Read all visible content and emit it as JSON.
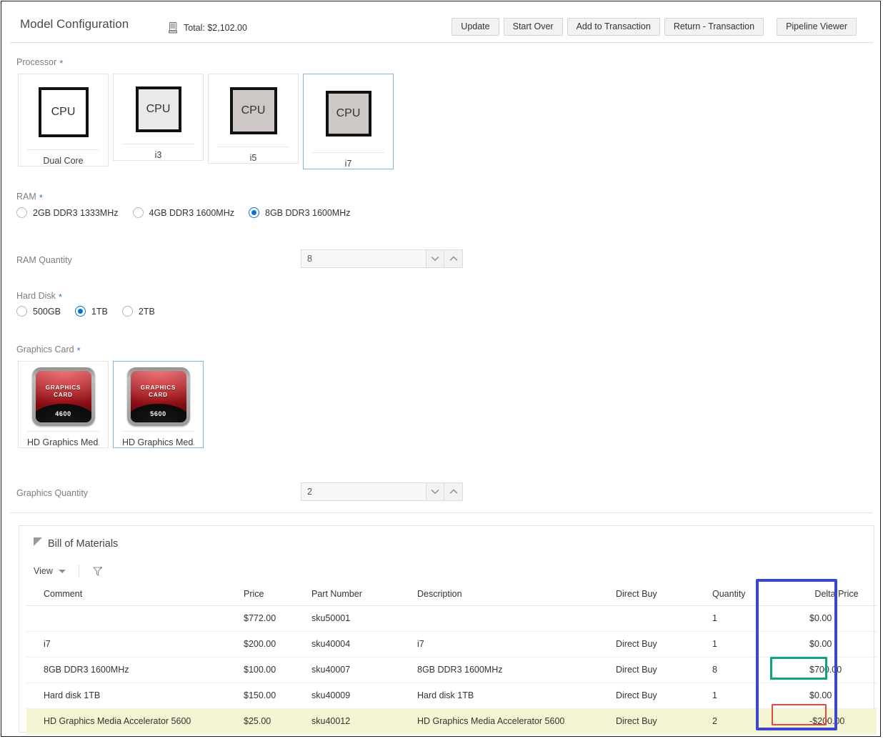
{
  "header": {
    "title": "Model Configuration",
    "total_label": "Total: $2,102.00",
    "total_icon": "server-icon",
    "buttons": [
      {
        "label": "Update",
        "name": "update-button"
      },
      {
        "label": "Start Over",
        "name": "start-over-button"
      },
      {
        "label": "Add to Transaction",
        "name": "add-to-transaction-button"
      },
      {
        "label": "Return - Transaction",
        "name": "return-transaction-button"
      },
      {
        "label": "Pipeline Viewer",
        "name": "pipeline-viewer-button"
      }
    ]
  },
  "form": {
    "processor": {
      "label": "Processor",
      "required": "*",
      "options": [
        {
          "caption": "Dual Core",
          "art": "CPU",
          "fill": "#ffffff",
          "selected": false
        },
        {
          "caption": "i3",
          "art": "CPU",
          "fill": "#ebe9e7",
          "selected": false
        },
        {
          "caption": "i5",
          "art": "CPU",
          "fill": "#cdc7c5",
          "selected": false
        },
        {
          "caption": "i7",
          "art": "CPU",
          "fill": "#cdc7c5",
          "selected": true
        }
      ]
    },
    "ram": {
      "label": "RAM",
      "required": "*",
      "options": [
        {
          "label": "2GB DDR3 1333MHz",
          "selected": false
        },
        {
          "label": "4GB DDR3 1600MHz",
          "selected": false
        },
        {
          "label": "8GB DDR3 1600MHz",
          "selected": true
        }
      ]
    },
    "ram_quantity": {
      "label": "RAM Quantity",
      "value": "8",
      "placeholder": ""
    },
    "hard_disk": {
      "label": "Hard Disk",
      "required": "*",
      "options": [
        {
          "label": "500GB",
          "selected": false
        },
        {
          "label": "1TB",
          "selected": true
        },
        {
          "label": "2TB",
          "selected": false
        }
      ]
    },
    "graphics_card": {
      "label": "Graphics Card",
      "required": "*",
      "options": [
        {
          "caption": "HD Graphics Med...",
          "art_title": "GRAPHICS CARD",
          "art_number": "4600",
          "selected": false
        },
        {
          "caption": "HD Graphics Med...",
          "art_title": "GRAPHICS CARD",
          "art_number": "5600",
          "selected": true
        }
      ]
    },
    "graphics_quantity": {
      "label": "Graphics Quantity",
      "value": "2",
      "placeholder": ""
    }
  },
  "bom": {
    "title": "Bill of Materials",
    "collapse_icon": "collapse-triangle-icon",
    "toolbar": {
      "view_label": "View",
      "view_caret": "chevron-down-icon",
      "filter_icon": "add-filter-icon"
    },
    "columns": [
      "Comment",
      "Price",
      "Part Number",
      "Description",
      "Direct Buy",
      "Quantity",
      "Delta Price"
    ],
    "rows": [
      {
        "comment": "",
        "price": "$772.00",
        "part_number": "sku50001",
        "description": "",
        "direct_buy": "",
        "quantity": "1",
        "delta_price": "$0.00",
        "highlighted": false,
        "delta_annotation": "none"
      },
      {
        "comment": "i7",
        "price": "$200.00",
        "part_number": "sku40004",
        "description": "i7",
        "direct_buy": "Direct Buy",
        "quantity": "1",
        "delta_price": "$0.00",
        "highlighted": false,
        "delta_annotation": "none"
      },
      {
        "comment": "8GB DDR3 1600MHz",
        "price": "$100.00",
        "part_number": "sku40007",
        "description": "8GB DDR3 1600MHz",
        "direct_buy": "Direct Buy",
        "quantity": "8",
        "delta_price": "$700.00",
        "highlighted": false,
        "delta_annotation": "teal"
      },
      {
        "comment": "Hard disk 1TB",
        "price": "$150.00",
        "part_number": "sku40009",
        "description": "Hard disk 1TB",
        "direct_buy": "Direct Buy",
        "quantity": "1",
        "delta_price": "$0.00",
        "highlighted": false,
        "delta_annotation": "none"
      },
      {
        "comment": "HD Graphics Media Accelerator 5600",
        "price": "$25.00",
        "part_number": "sku40012",
        "description": "HD Graphics Media Accelerator 5600",
        "direct_buy": "Direct Buy",
        "quantity": "2",
        "delta_price": "-$200.00",
        "highlighted": true,
        "delta_annotation": "red"
      }
    ]
  },
  "annotations": {
    "column_highlight_color": "#3b46c8",
    "positive_delta_color": "#11a37f",
    "negative_delta_color": "#e8493b"
  }
}
